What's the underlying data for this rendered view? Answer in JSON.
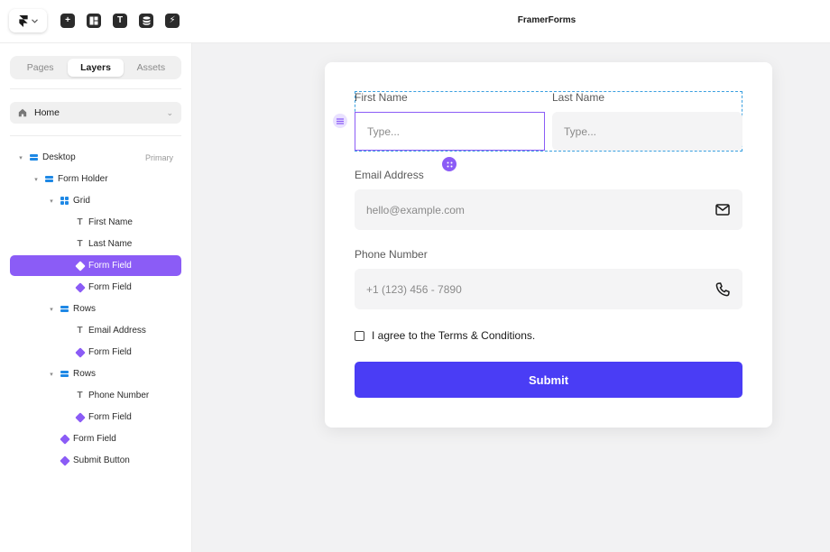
{
  "app": {
    "title": "FramerForms"
  },
  "toolbar": {
    "logo_icon": "framer-logo-icon",
    "tools": [
      {
        "name": "insert-icon",
        "glyph": "+"
      },
      {
        "name": "layout-icon",
        "glyph": ""
      },
      {
        "name": "text-icon",
        "glyph": "T"
      },
      {
        "name": "cms-icon",
        "glyph": ""
      },
      {
        "name": "interactions-icon",
        "glyph": "⚡"
      }
    ]
  },
  "sidebar": {
    "tabs": [
      "Pages",
      "Layers",
      "Assets"
    ],
    "active_tab": "Layers",
    "page_select": {
      "label": "Home"
    },
    "layers": [
      {
        "label": "Desktop",
        "type": "stack",
        "depth": 0,
        "twisty": true,
        "tag": "Primary"
      },
      {
        "label": "Form Holder",
        "type": "stack",
        "depth": 1,
        "twisty": true
      },
      {
        "label": "Grid",
        "type": "grid",
        "depth": 2,
        "twisty": true
      },
      {
        "label": "First Name",
        "type": "text",
        "depth": 3
      },
      {
        "label": "Last Name",
        "type": "text",
        "depth": 3
      },
      {
        "label": "Form Field",
        "type": "component",
        "depth": 3,
        "selected": true
      },
      {
        "label": "Form Field",
        "type": "component",
        "depth": 3
      },
      {
        "label": "Rows",
        "type": "stack",
        "depth": 2,
        "twisty": true
      },
      {
        "label": "Email Address",
        "type": "text",
        "depth": 3
      },
      {
        "label": "Form Field",
        "type": "component",
        "depth": 3
      },
      {
        "label": "Rows",
        "type": "stack",
        "depth": 2,
        "twisty": true
      },
      {
        "label": "Phone Number",
        "type": "text",
        "depth": 3
      },
      {
        "label": "Form Field",
        "type": "component",
        "depth": 3
      },
      {
        "label": "Form Field",
        "type": "component",
        "depth": 2
      },
      {
        "label": "Submit Button",
        "type": "component",
        "depth": 2
      }
    ]
  },
  "form": {
    "first_name": {
      "label": "First Name",
      "placeholder": "Type..."
    },
    "last_name": {
      "label": "Last Name",
      "placeholder": "Type..."
    },
    "email": {
      "label": "Email Address",
      "placeholder": "hello@example.com",
      "icon": "mail-icon"
    },
    "phone": {
      "label": "Phone Number",
      "placeholder": "+1 (123) 456 - 7890",
      "icon": "phone-icon"
    },
    "agree": "I agree to the Terms & Conditions.",
    "agree_checked": false,
    "submit": "Submit"
  },
  "colors": {
    "accent": "#8b5cf6",
    "submit": "#4a3df5",
    "stack": "#1e88e5"
  }
}
